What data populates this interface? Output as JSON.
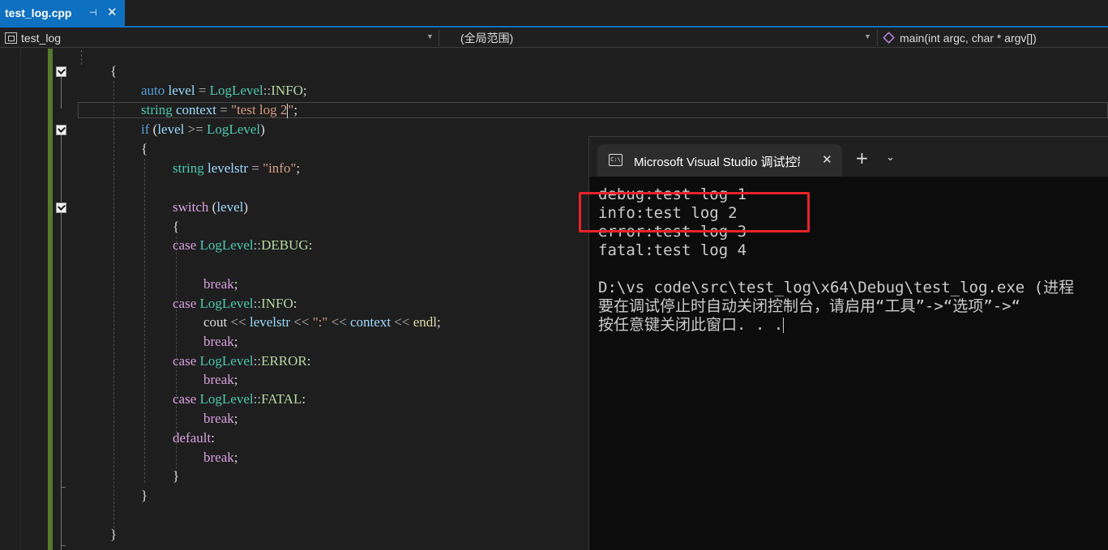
{
  "tab": {
    "title": "test_log.cpp",
    "pin_icon": "pin-icon",
    "close_icon": "close-icon"
  },
  "navbar": {
    "project": "test_log",
    "scope": "(全局范围)",
    "member": "main(int argc, char * argv[])"
  },
  "code": [
    {
      "tokens": [
        {
          "t": "{",
          "c": "txt"
        }
      ]
    },
    {
      "tokens": [
        {
          "t": "auto ",
          "c": "kw"
        },
        {
          "t": "level",
          "c": "var"
        },
        {
          "t": " = ",
          "c": "op"
        },
        {
          "t": "LogLevel",
          "c": "ty"
        },
        {
          "t": "::",
          "c": "op"
        },
        {
          "t": "INFO",
          "c": "en"
        },
        {
          "t": ";",
          "c": "txt"
        }
      ]
    },
    {
      "tokens": [
        {
          "t": "string ",
          "c": "ty"
        },
        {
          "t": "context",
          "c": "var"
        },
        {
          "t": " = ",
          "c": "op"
        },
        {
          "t": "\"test log 2",
          "c": "str"
        },
        {
          "t": "|caret|",
          "c": "caret"
        },
        {
          "t": "\"",
          "c": "str"
        },
        {
          "t": ";",
          "c": "txt"
        }
      ]
    },
    {
      "tokens": [
        {
          "t": "if ",
          "c": "kw"
        },
        {
          "t": "(",
          "c": "txt"
        },
        {
          "t": "level",
          "c": "var"
        },
        {
          "t": " >= ",
          "c": "op"
        },
        {
          "t": "LogLevel",
          "c": "ty"
        },
        {
          "t": ")",
          "c": "txt"
        }
      ]
    },
    {
      "tokens": [
        {
          "t": "{",
          "c": "txt"
        }
      ]
    },
    {
      "tokens": [
        {
          "t": "string ",
          "c": "ty"
        },
        {
          "t": "levelstr",
          "c": "var"
        },
        {
          "t": " = ",
          "c": "op"
        },
        {
          "t": "\"info\"",
          "c": "str"
        },
        {
          "t": ";",
          "c": "txt"
        }
      ]
    },
    {
      "tokens": []
    },
    {
      "tokens": [
        {
          "t": "switch ",
          "c": "kw2"
        },
        {
          "t": "(",
          "c": "txt"
        },
        {
          "t": "level",
          "c": "var"
        },
        {
          "t": ")",
          "c": "txt"
        }
      ]
    },
    {
      "tokens": [
        {
          "t": "{",
          "c": "txt"
        }
      ]
    },
    {
      "tokens": [
        {
          "t": "case ",
          "c": "kw2"
        },
        {
          "t": "LogLevel",
          "c": "ty"
        },
        {
          "t": "::",
          "c": "op"
        },
        {
          "t": "DEBUG",
          "c": "en"
        },
        {
          "t": ":",
          "c": "txt"
        }
      ]
    },
    {
      "tokens": []
    },
    {
      "tokens": [
        {
          "t": "break",
          "c": "kw2"
        },
        {
          "t": ";",
          "c": "txt"
        }
      ]
    },
    {
      "tokens": [
        {
          "t": "case ",
          "c": "kw2"
        },
        {
          "t": "LogLevel",
          "c": "ty"
        },
        {
          "t": "::",
          "c": "op"
        },
        {
          "t": "INFO",
          "c": "en"
        },
        {
          "t": ":",
          "c": "txt"
        }
      ]
    },
    {
      "tokens": [
        {
          "t": "cout",
          "c": "txt"
        },
        {
          "t": " << ",
          "c": "op"
        },
        {
          "t": "levelstr",
          "c": "var"
        },
        {
          "t": " << ",
          "c": "op"
        },
        {
          "t": "\":\"",
          "c": "str"
        },
        {
          "t": " << ",
          "c": "op"
        },
        {
          "t": "context",
          "c": "var"
        },
        {
          "t": " << ",
          "c": "op"
        },
        {
          "t": "endl",
          "c": "fn"
        },
        {
          "t": ";",
          "c": "txt"
        }
      ]
    },
    {
      "tokens": [
        {
          "t": "break",
          "c": "kw2"
        },
        {
          "t": ";",
          "c": "txt"
        }
      ]
    },
    {
      "tokens": [
        {
          "t": "case ",
          "c": "kw2"
        },
        {
          "t": "LogLevel",
          "c": "ty"
        },
        {
          "t": "::",
          "c": "op"
        },
        {
          "t": "ERROR",
          "c": "en"
        },
        {
          "t": ":",
          "c": "txt"
        }
      ]
    },
    {
      "tokens": [
        {
          "t": "break",
          "c": "kw2"
        },
        {
          "t": ";",
          "c": "txt"
        }
      ]
    },
    {
      "tokens": [
        {
          "t": "case ",
          "c": "kw2"
        },
        {
          "t": "LogLevel",
          "c": "ty"
        },
        {
          "t": "::",
          "c": "op"
        },
        {
          "t": "FATAL",
          "c": "en"
        },
        {
          "t": ":",
          "c": "txt"
        }
      ]
    },
    {
      "tokens": [
        {
          "t": "break",
          "c": "kw2"
        },
        {
          "t": ";",
          "c": "txt"
        }
      ]
    },
    {
      "tokens": [
        {
          "t": "default",
          "c": "kw2"
        },
        {
          "t": ":",
          "c": "txt"
        }
      ]
    },
    {
      "tokens": [
        {
          "t": "break",
          "c": "kw2"
        },
        {
          "t": ";",
          "c": "txt"
        }
      ]
    },
    {
      "tokens": [
        {
          "t": "}",
          "c": "txt"
        }
      ]
    },
    {
      "tokens": [
        {
          "t": "}",
          "c": "txt"
        }
      ]
    },
    {
      "tokens": []
    },
    {
      "tokens": [
        {
          "t": "}",
          "c": "txt"
        }
      ]
    }
  ],
  "console": {
    "title": "Microsoft Visual Studio 调试控制台",
    "icon": "terminal-icon",
    "lines": [
      "debug:test log 1",
      "info:test log 2",
      "error:test log 3",
      "fatal:test log 4",
      "",
      "D:\\vs code\\src\\test_log\\x64\\Debug\\test_log.exe (进程",
      "要在调试停止时自动关闭控制台，请启用“工具”->“选项”->“",
      "按任意键关闭此窗口. . ."
    ]
  },
  "colors": {
    "accent": "#0e70c0",
    "highlight": "#e8232a",
    "change_bar": "#557a2e"
  }
}
